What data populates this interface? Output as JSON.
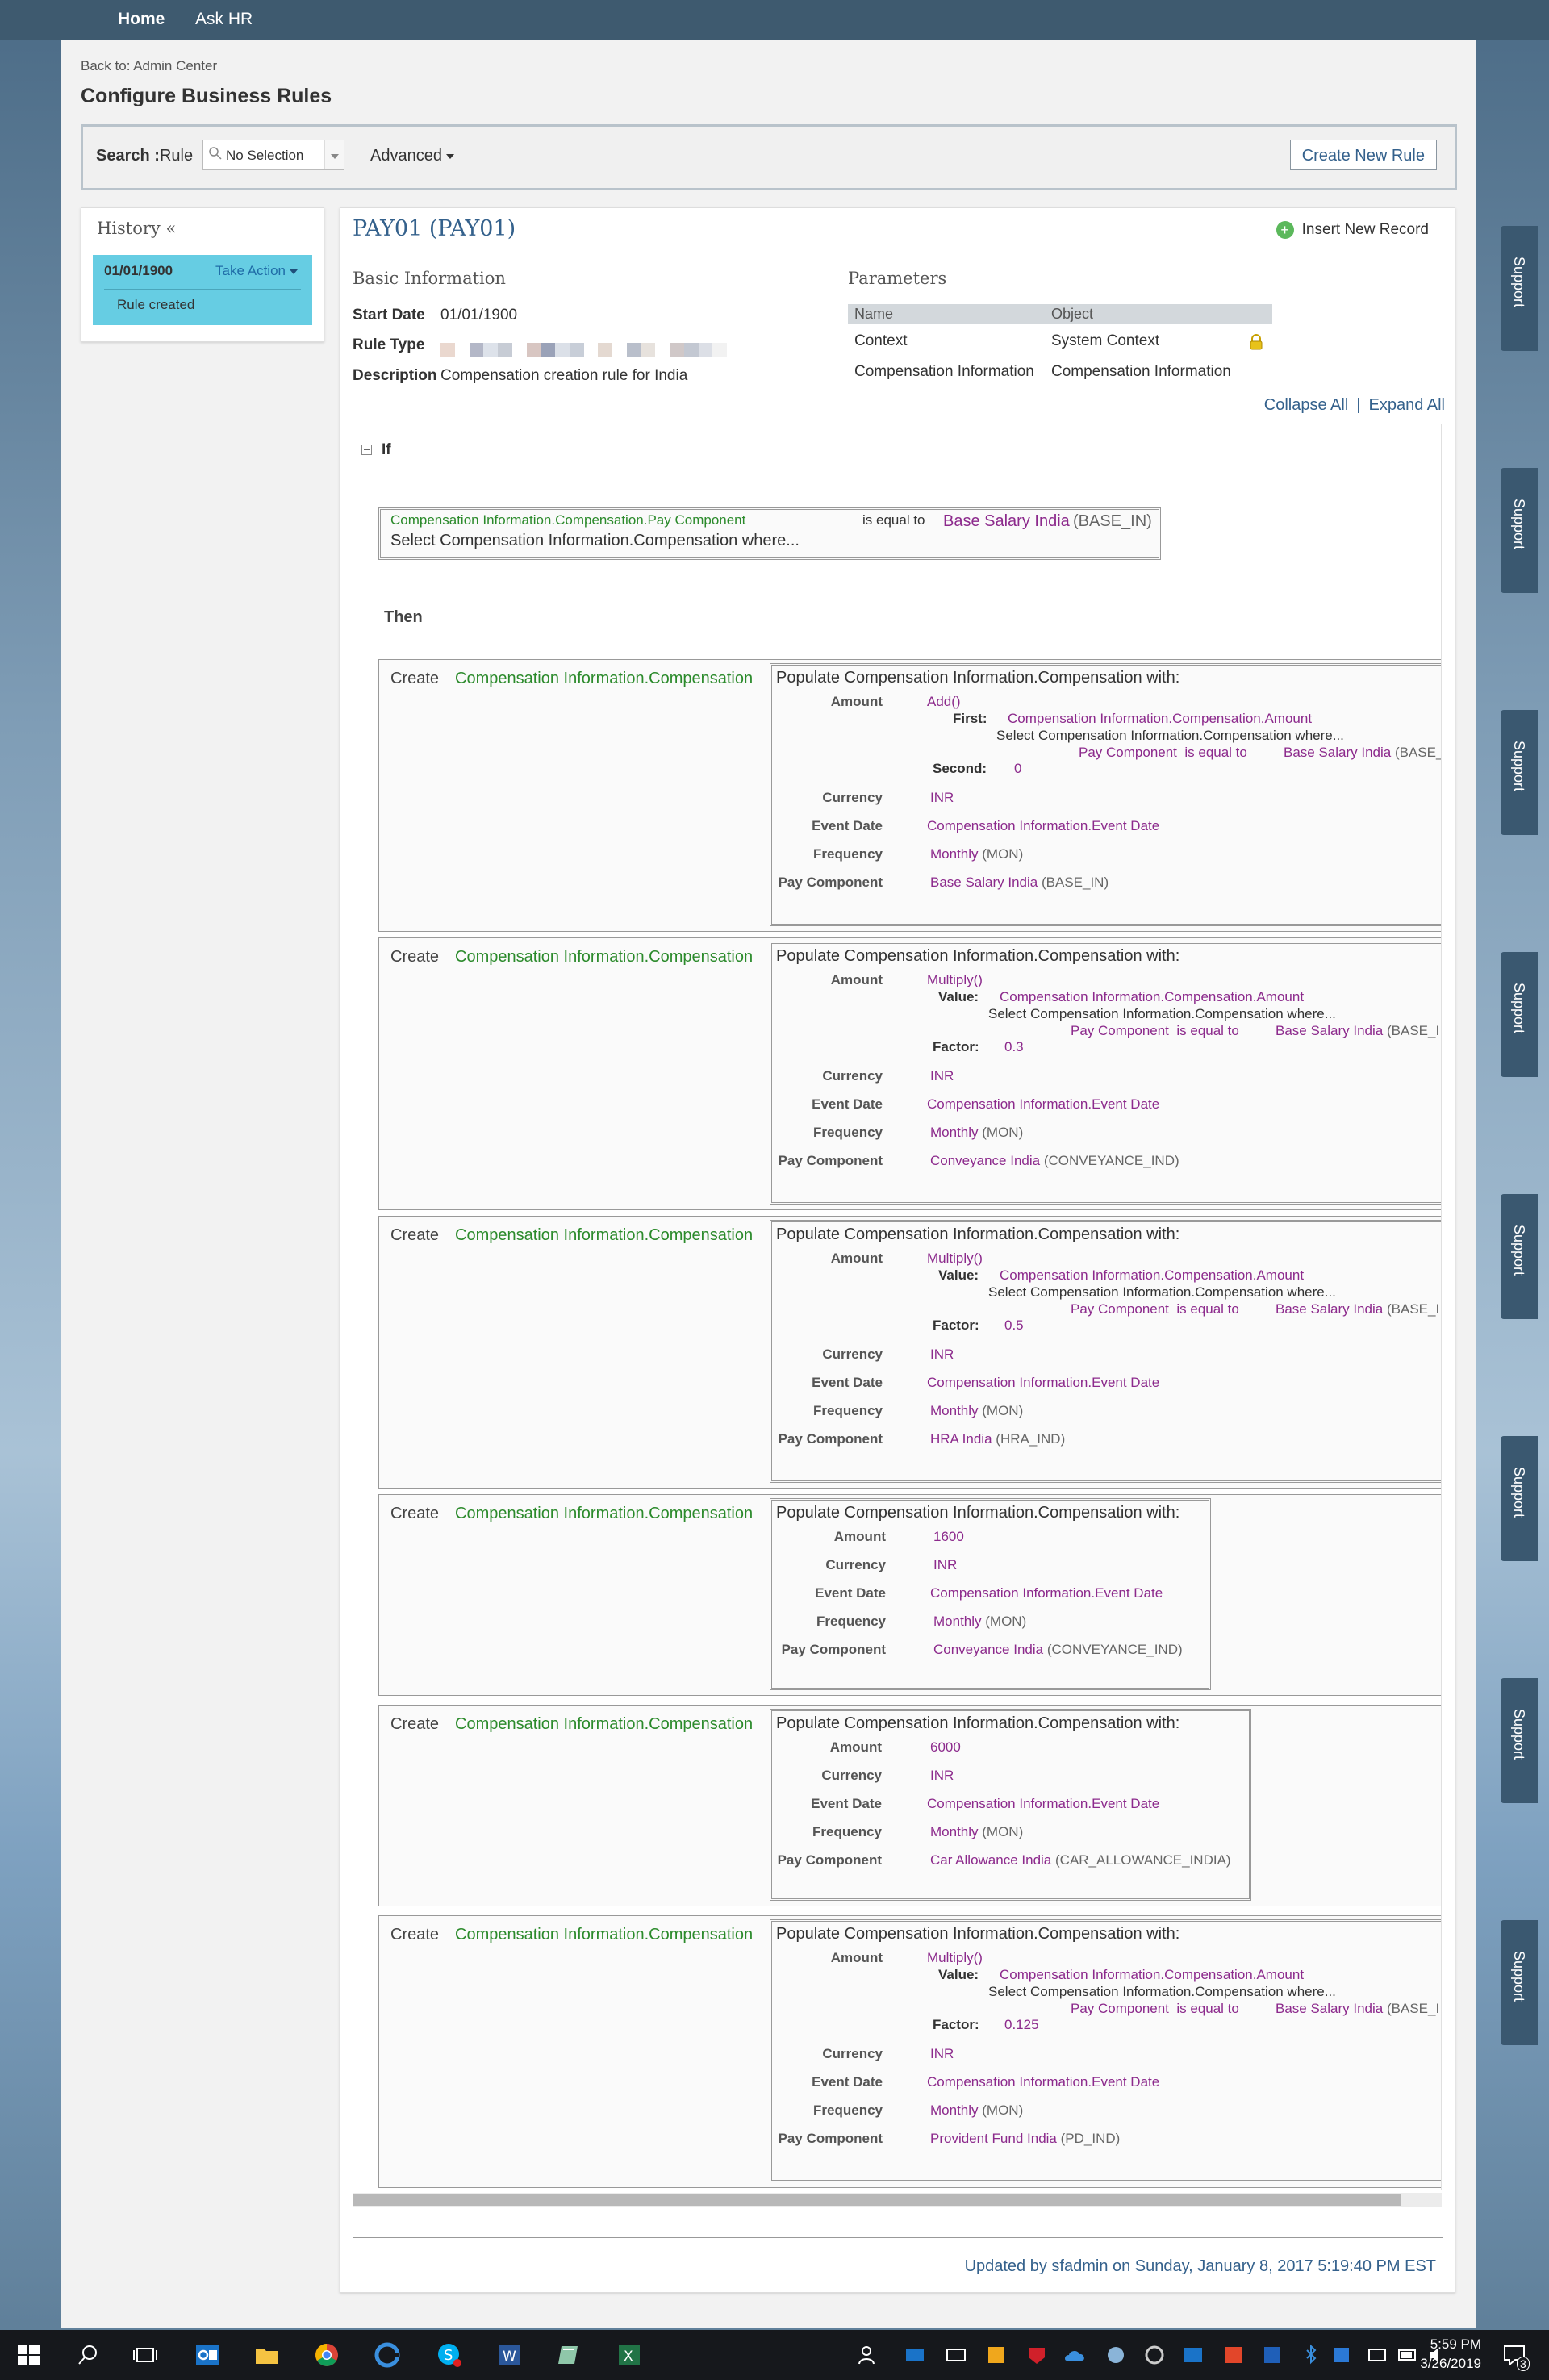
{
  "nav": {
    "home": "Home",
    "ask_hr": "Ask HR"
  },
  "back_link": "Back to: Admin Center",
  "page_title": "Configure Business Rules",
  "search": {
    "label_bold": "Search :",
    "label": "Rule",
    "value": "No Selection",
    "advanced": "Advanced",
    "create_button": "Create New Rule"
  },
  "history": {
    "title": "History «",
    "date": "01/01/1900",
    "take_action": "Take Action",
    "note": "Rule created"
  },
  "rule": {
    "title": "PAY01 (PAY01)",
    "insert": "Insert New Record",
    "basic_heading": "Basic Information",
    "start_date_label": "Start Date",
    "start_date": "01/01/1900",
    "rule_type_label": "Rule Type",
    "description_label": "Description",
    "description": "Compensation creation rule for India",
    "params_heading": "Parameters",
    "params_col_name": "Name",
    "params_col_object": "Object",
    "params": [
      {
        "name": "Context",
        "object": "System Context"
      },
      {
        "name": "Compensation Information",
        "object": "Compensation Information"
      }
    ],
    "collapse_all": "Collapse All",
    "expand_all": "Expand All"
  },
  "if_label": "If",
  "condition": {
    "field": "Compensation Information.Compensation.Pay Component",
    "op": "is equal to",
    "value": "Base Salary India",
    "code": "(BASE_IN)",
    "where": "Select Compensation Information.Compensation where..."
  },
  "then_label": "Then",
  "blocks_common": {
    "create": "Create",
    "object": "Compensation Information.Compensation",
    "populate": "Populate Compensation Information.Compensation with:",
    "amount_label": "Amount",
    "currency_label": "Currency",
    "event_date_label": "Event Date",
    "frequency_label": "Frequency",
    "pay_component_label": "Pay Component",
    "currency": "INR",
    "event_date": "Compensation Information.Event Date",
    "frequency": "Monthly",
    "frequency_code": "(MON)",
    "comp_amount": "Compensation Information.Compensation.Amount",
    "where": "Select Compensation Information.Compensation where...",
    "pc_field": "Pay Component",
    "is_equal": "is equal to",
    "base_salary": "Base Salary India",
    "base_code_1": "(BASE_",
    "base_code_2": "(BASE_I"
  },
  "blocks": [
    {
      "fn": "Add()",
      "arg1_label": "First:",
      "arg2_label": "Second:",
      "arg2": "0",
      "pc_name": "Base Salary India",
      "pc_code": "(BASE_IN)"
    },
    {
      "fn": "Multiply()",
      "arg1_label": "Value:",
      "arg2_label": "Factor:",
      "arg2": "0.3",
      "pc_name": "Conveyance India",
      "pc_code": "(CONVEYANCE_IND)"
    },
    {
      "fn": "Multiply()",
      "arg1_label": "Value:",
      "arg2_label": "Factor:",
      "arg2": "0.5",
      "pc_name": "HRA India",
      "pc_code": "(HRA_IND)"
    },
    {
      "amount": "1600",
      "pc_name": "Conveyance India",
      "pc_code": "(CONVEYANCE_IND)"
    },
    {
      "amount": "6000",
      "pc_name": "Car Allowance India",
      "pc_code": "(CAR_ALLOWANCE_INDIA)"
    },
    {
      "fn": "Multiply()",
      "arg1_label": "Value:",
      "arg2_label": "Factor:",
      "arg2": "0.125",
      "pc_name": "Provident Fund India",
      "pc_code": "(PD_IND)"
    }
  ],
  "updated": "Updated by sfadmin on Sunday, January 8, 2017 5:19:40 PM EST",
  "support": "Support",
  "clock": {
    "time": "5:59 PM",
    "date": "3/26/2019"
  },
  "notification_count": "3",
  "colors": {
    "accent": "#34618c",
    "green_text": "#2b8a2b",
    "purple_text": "#8c2a8c",
    "history_item": "#66cde3",
    "nav": "#3e5a6f"
  }
}
